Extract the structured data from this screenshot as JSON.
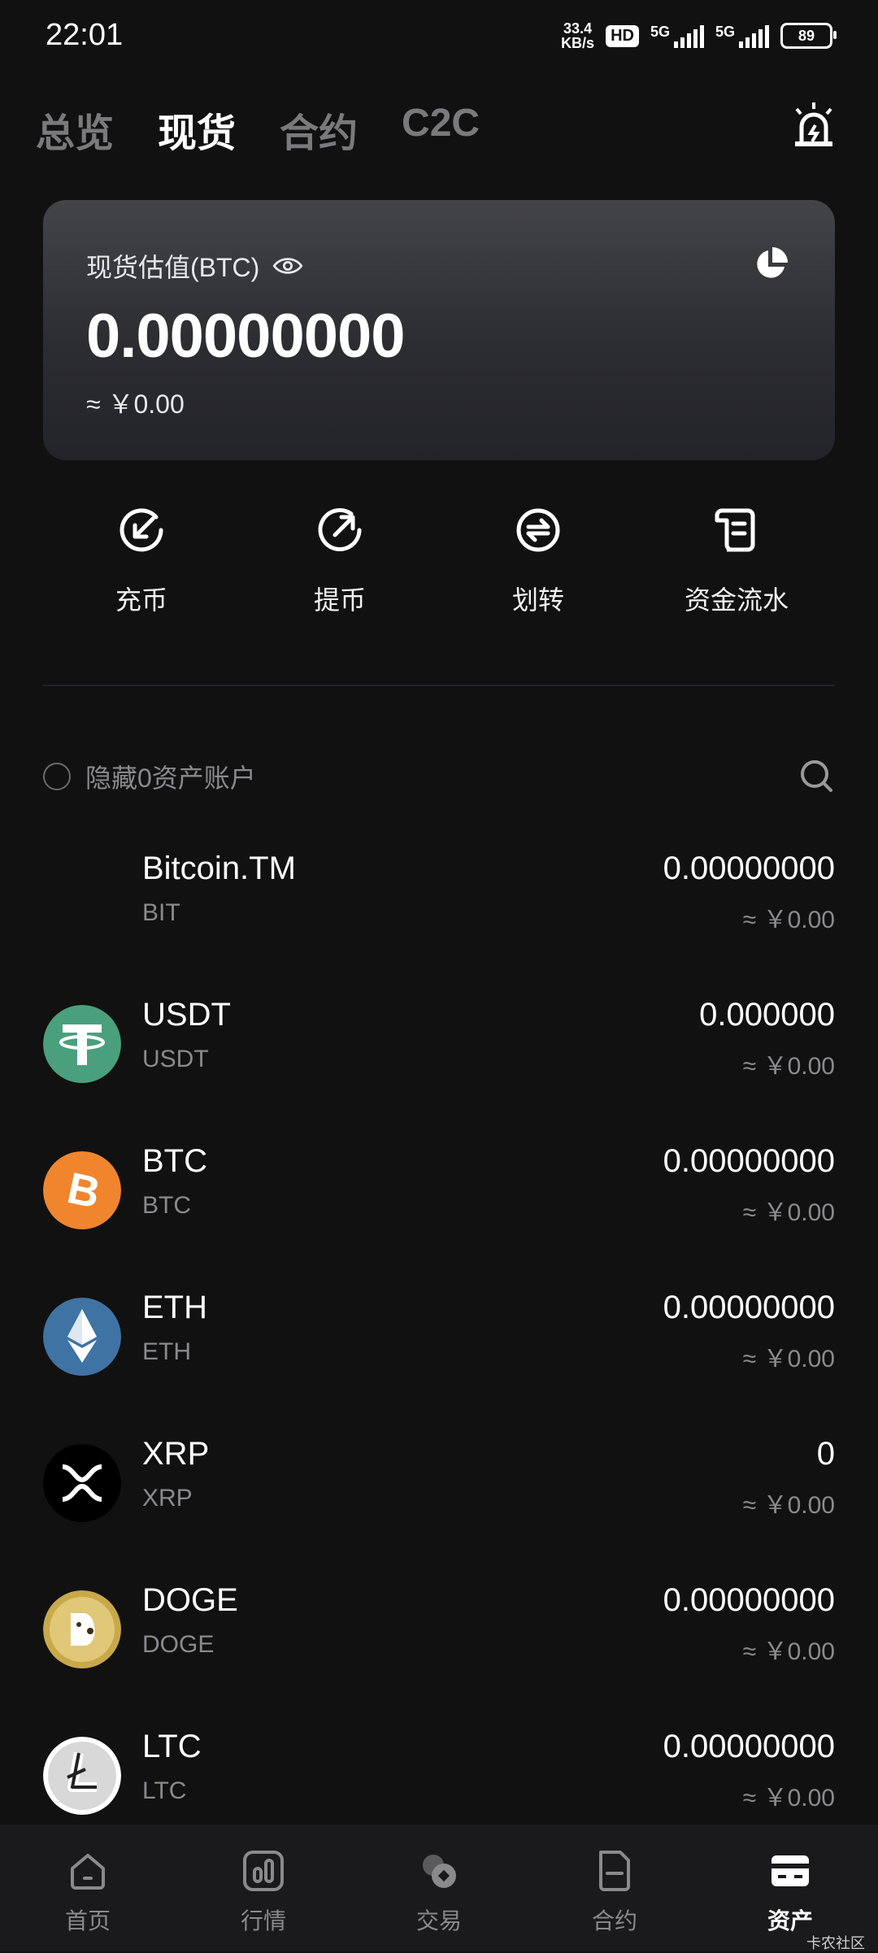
{
  "status_bar": {
    "time": "22:01",
    "net_speed_top": "33.4",
    "net_speed_bottom": "KB/s",
    "hd_badge": "HD",
    "signal1_label": "5G",
    "signal2_label": "5G",
    "battery": "89"
  },
  "tabs": [
    {
      "label": "总览"
    },
    {
      "label": "现货"
    },
    {
      "label": "合约"
    },
    {
      "label": "C2C"
    }
  ],
  "active_tab": "现货",
  "valuation": {
    "label": "现货估值(BTC)",
    "value": "0.00000000",
    "cny": "≈ ￥0.00"
  },
  "actions": [
    {
      "label": "充币",
      "icon": "deposit-icon"
    },
    {
      "label": "提币",
      "icon": "withdraw-icon"
    },
    {
      "label": "划转",
      "icon": "transfer-icon"
    },
    {
      "label": "资金流水",
      "icon": "ledger-icon"
    }
  ],
  "hide_zero_label": "隐藏0资产账户",
  "assets": [
    {
      "name": "Bitcoin.TM",
      "symbol": "BIT",
      "amount": "0.00000000",
      "cny": "≈ ￥0.00",
      "icon": "none",
      "color": ""
    },
    {
      "name": "USDT",
      "symbol": "USDT",
      "amount": "0.000000",
      "cny": "≈ ￥0.00",
      "icon": "tether-icon",
      "color": "#4aa07c"
    },
    {
      "name": "BTC",
      "symbol": "BTC",
      "amount": "0.00000000",
      "cny": "≈ ￥0.00",
      "icon": "bitcoin-icon",
      "color": "#f0852e"
    },
    {
      "name": "ETH",
      "symbol": "ETH",
      "amount": "0.00000000",
      "cny": "≈ ￥0.00",
      "icon": "ethereum-icon",
      "color": "#3f73a4"
    },
    {
      "name": "XRP",
      "symbol": "XRP",
      "amount": "0",
      "cny": "≈ ￥0.00",
      "icon": "xrp-icon",
      "color": "#000000"
    },
    {
      "name": "DOGE",
      "symbol": "DOGE",
      "amount": "0.00000000",
      "cny": "≈ ￥0.00",
      "icon": "dogecoin-icon",
      "color": "#c8a94a"
    },
    {
      "name": "LTC",
      "symbol": "LTC",
      "amount": "0.00000000",
      "cny": "≈ ￥0.00",
      "icon": "litecoin-icon",
      "color": "#ffffff"
    }
  ],
  "bottom_nav": [
    {
      "label": "首页",
      "icon": "home-icon"
    },
    {
      "label": "行情",
      "icon": "market-icon"
    },
    {
      "label": "交易",
      "icon": "trade-icon"
    },
    {
      "label": "合约",
      "icon": "contract-icon"
    },
    {
      "label": "资产",
      "icon": "wallet-icon"
    }
  ],
  "active_nav": "资产",
  "watermark": "卡农社区"
}
